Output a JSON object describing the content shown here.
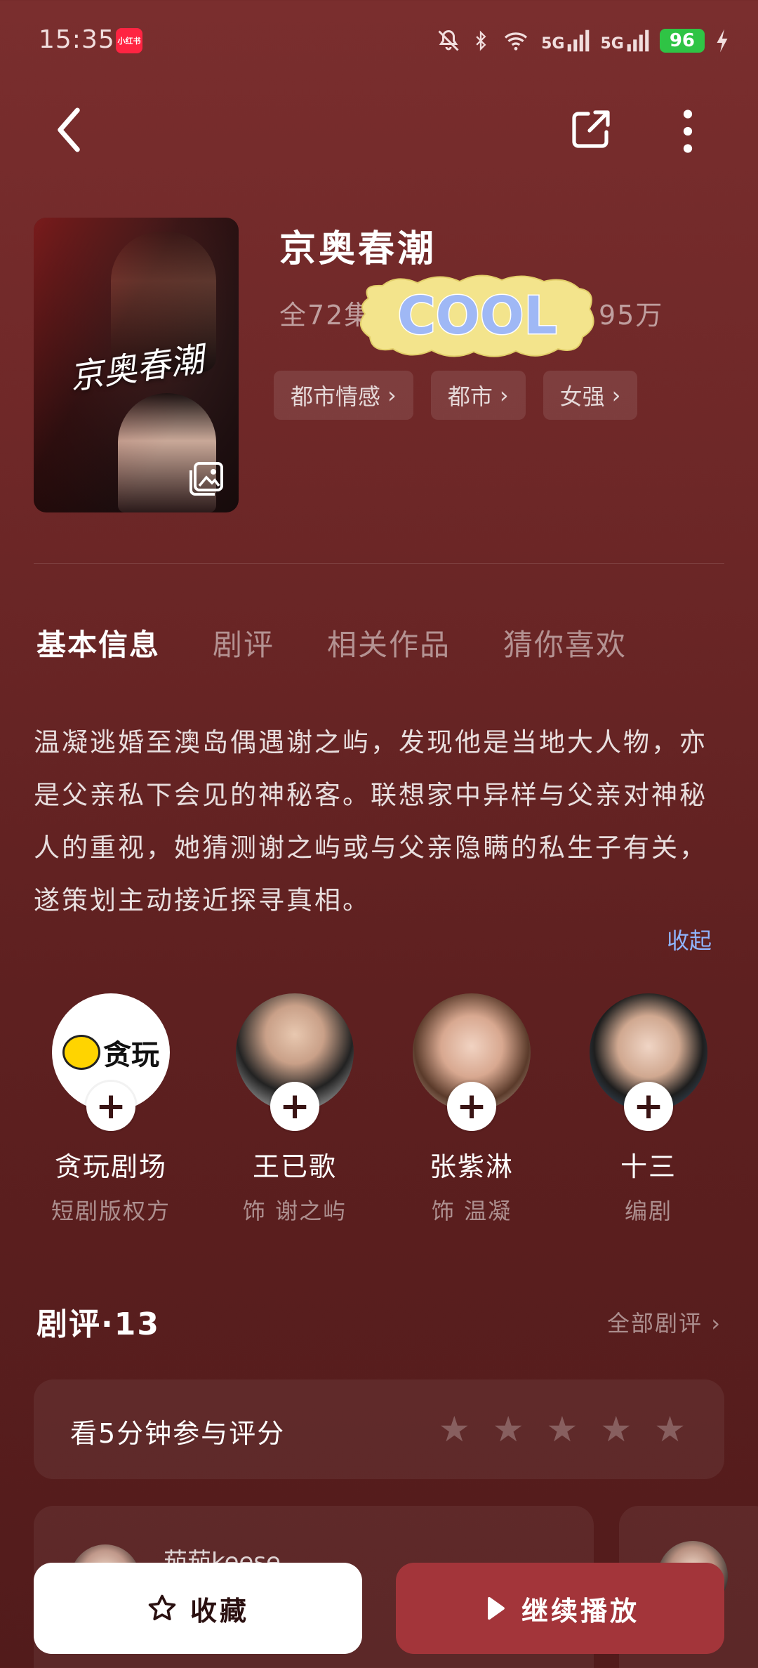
{
  "status_bar": {
    "time": "15:35",
    "app_badge": "小红书",
    "signal_1": "5G",
    "signal_2": "5G",
    "battery": "96",
    "icons": [
      "mute-icon",
      "bluetooth-icon",
      "wifi-icon",
      "signal-icon",
      "signal-icon",
      "battery-icon",
      "charging-icon"
    ]
  },
  "nav": {
    "back_icon": "chevron-left-icon",
    "share_icon": "share-icon",
    "more_icon": "more-vertical-icon"
  },
  "drama": {
    "poster_title": "京奥春潮",
    "title": "京奥春潮",
    "episodes": "全72集",
    "views": "95万",
    "sticker_text": "COOL",
    "tags": [
      {
        "label": "都市情感"
      },
      {
        "label": "都市"
      },
      {
        "label": "女强"
      }
    ]
  },
  "tabs": [
    {
      "label": "基本信息",
      "active": true
    },
    {
      "label": "剧评",
      "active": false
    },
    {
      "label": "相关作品",
      "active": false
    },
    {
      "label": "猜你喜欢",
      "active": false
    }
  ],
  "synopsis": {
    "text": "温凝逃婚至澳岛偶遇谢之屿，发现他是当地大人物，亦是父亲私下会见的神秘客。联想家中异样与父亲对神秘人的重视，她猜测谢之屿或与父亲隐瞒的私生子有关，遂策划主动接近探寻真相。",
    "collapse_label": "收起"
  },
  "cast": [
    {
      "name": "贪玩剧场",
      "role": "短剧版权方",
      "logo_text": "贪玩"
    },
    {
      "name": "王已歌",
      "role": "饰 谢之屿"
    },
    {
      "name": "张紫淋",
      "role": "饰 温凝"
    },
    {
      "name": "十三",
      "role": "编剧"
    }
  ],
  "reviews": {
    "heading": "剧评·13",
    "all_label": "全部剧评",
    "rate_prompt": "看5分钟参与评分",
    "rating_stars": 0,
    "max_stars": 5,
    "first_user": "茄茄keese"
  },
  "actions": {
    "favorite_label": "收藏",
    "play_label": "继续播放"
  }
}
